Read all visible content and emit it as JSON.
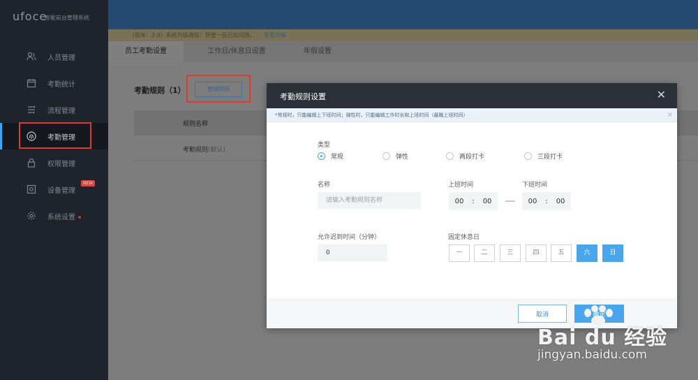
{
  "app": {
    "logo": "ufoce",
    "subtitle": "智能前台管理系统"
  },
  "sidebar": {
    "items": [
      {
        "label": "人员管理",
        "icon": "people-icon"
      },
      {
        "label": "考勤统计",
        "icon": "calendar-icon"
      },
      {
        "label": "流程管理",
        "icon": "flow-icon"
      },
      {
        "label": "考勤管理",
        "icon": "fingerprint-icon",
        "active": true
      },
      {
        "label": "权限管理",
        "icon": "lock-icon"
      },
      {
        "label": "设备管理",
        "icon": "device-icon",
        "badge": "NEW"
      },
      {
        "label": "系统设置",
        "icon": "gear-icon",
        "dot": true
      }
    ]
  },
  "notice": {
    "text": "（版本：2.9）系统升级通知：想要一些已知问题。",
    "link": "查看详情"
  },
  "tabs": [
    {
      "label": "员工考勤设置",
      "active": true
    },
    {
      "label": "工作日/休息日设置"
    },
    {
      "label": "年假设置"
    }
  ],
  "rules": {
    "title": "考勤规则（1）",
    "manage_button": "管理规则",
    "column_name": "规则名称",
    "row_name": "考勤规则",
    "row_suffix": "(默认)"
  },
  "modal": {
    "title": "考勤规则设置",
    "close": "✕",
    "tip": "*常规时，只能编辑上下班时间；弹性时，只能编辑工作时长和上班时间（最晚上班时间）",
    "tip_close": "×",
    "type_label": "类型",
    "types": [
      "常规",
      "弹性",
      "两段打卡",
      "三段打卡"
    ],
    "selected_type": "常规",
    "name_label": "名称",
    "name_placeholder": "请输入考勤规则名称",
    "start_label": "上班时间",
    "end_label": "下班时间",
    "start_hour": "00",
    "start_min": "00",
    "end_hour": "00",
    "end_min": "00",
    "time_sep": ":",
    "late_label": "允许迟到时间（分钟）",
    "late_value": "0",
    "rest_label": "固定休息日",
    "days": [
      "一",
      "二",
      "三",
      "四",
      "五",
      "六",
      "日"
    ],
    "days_selected": [
      "六",
      "日"
    ],
    "cancel": "取消",
    "confirm": "确定"
  },
  "watermark": {
    "brand": "Bai du 经验",
    "url": "jingyan.baidu.com"
  },
  "colors": {
    "accent": "#4aa6ec",
    "highlight": "#e03a2f",
    "sidebar": "#1f232b",
    "header": "#234a72"
  }
}
